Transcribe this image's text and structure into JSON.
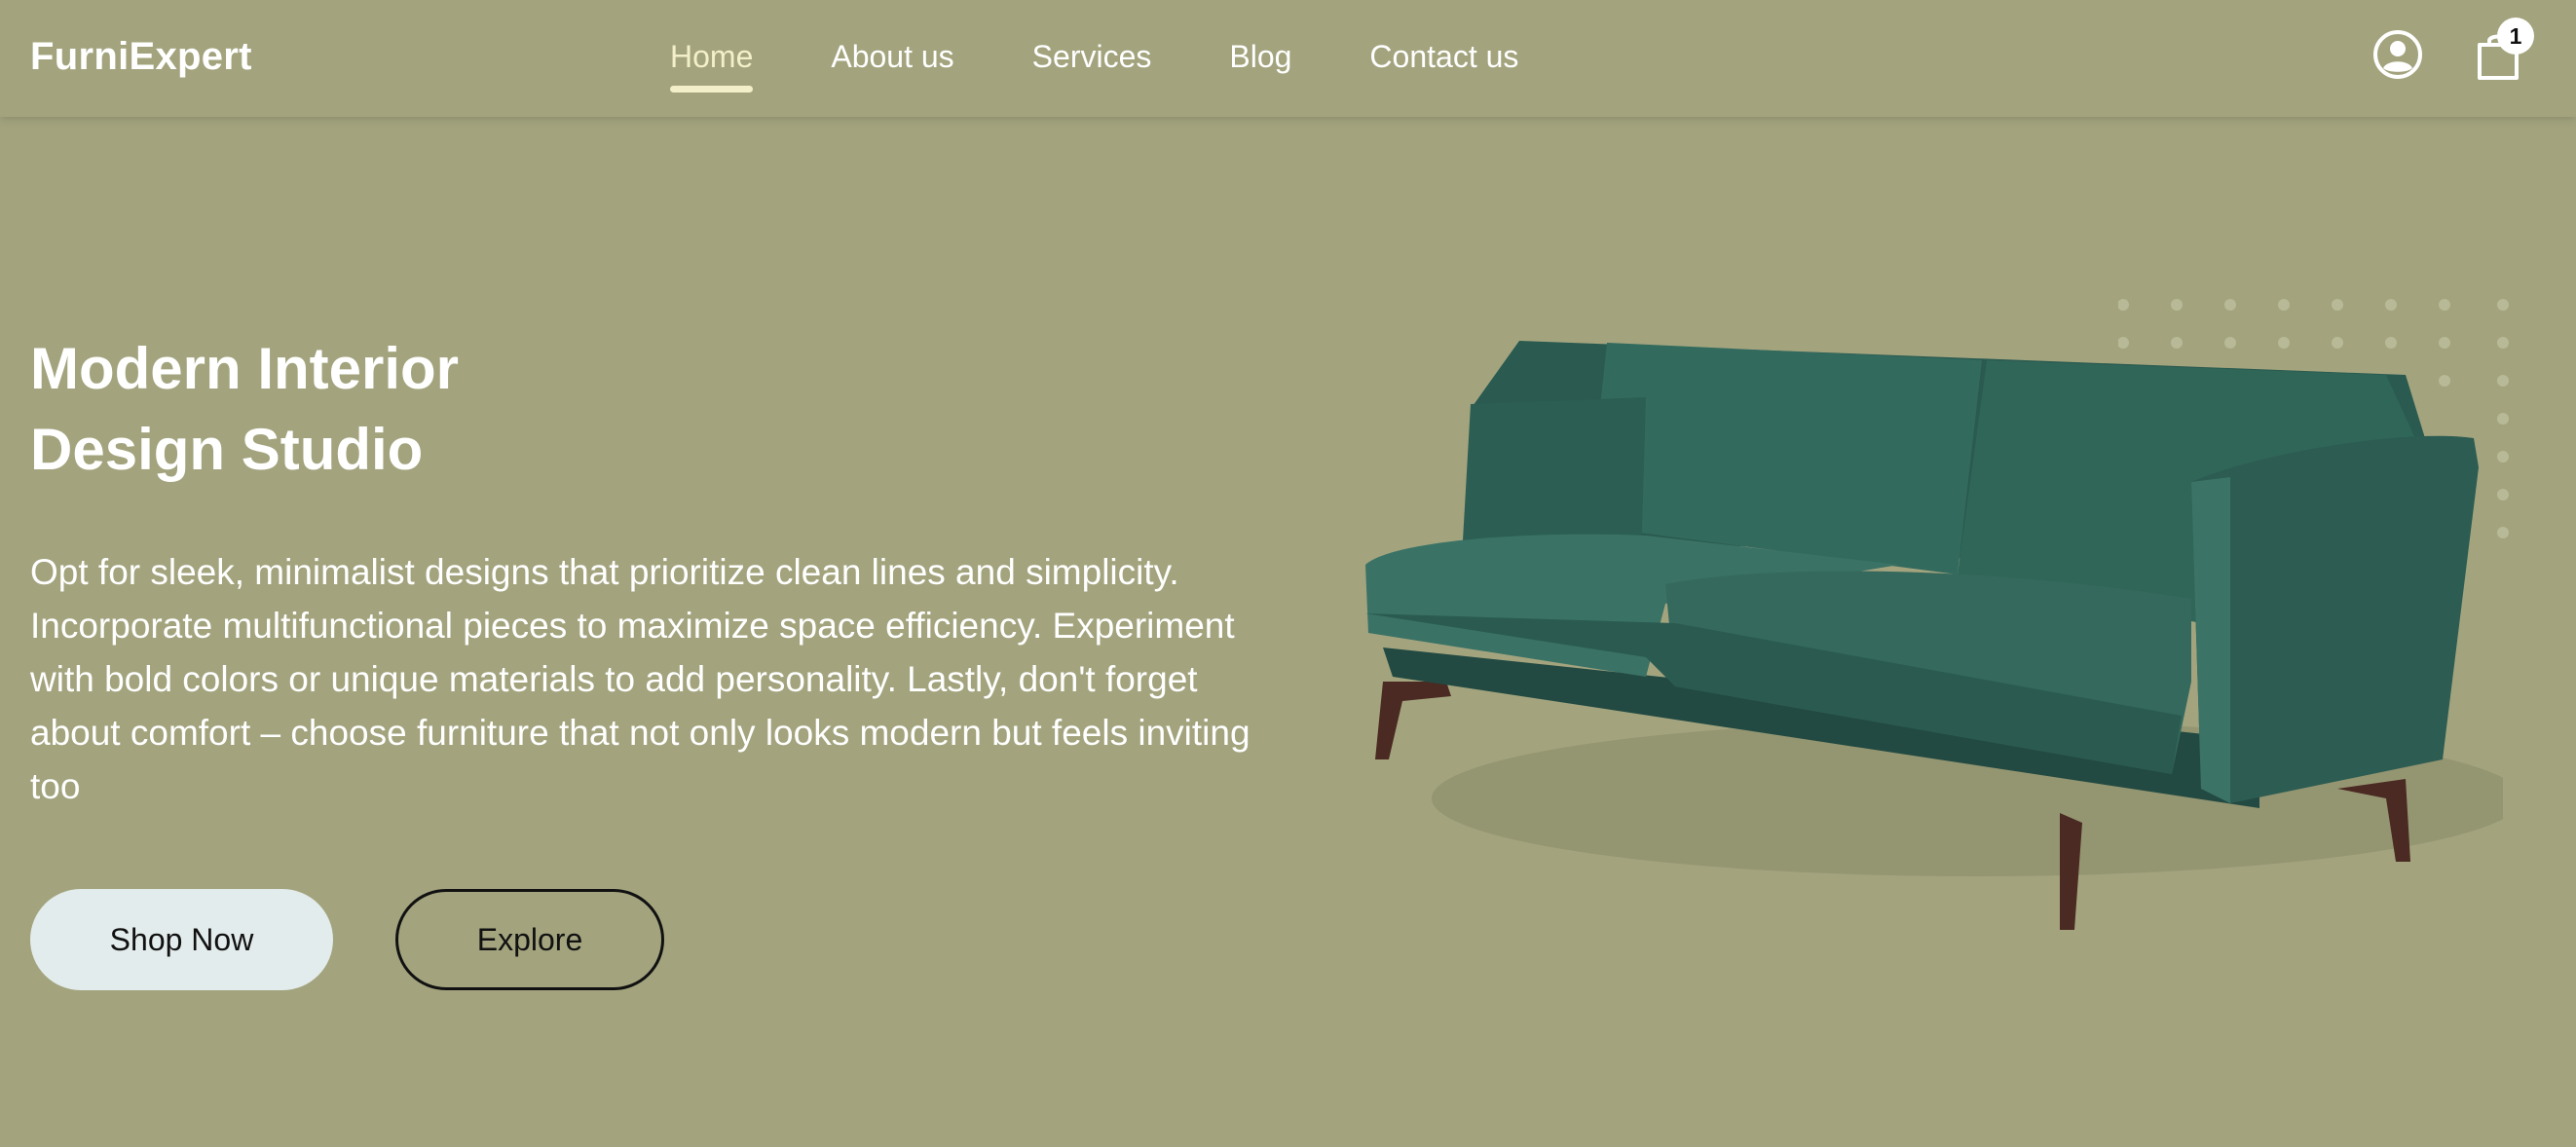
{
  "brand": "FurniExpert",
  "nav": {
    "items": [
      {
        "label": "Home",
        "active": true
      },
      {
        "label": "About us",
        "active": false
      },
      {
        "label": "Services",
        "active": false
      },
      {
        "label": "Blog",
        "active": false
      },
      {
        "label": "Contact us",
        "active": false
      }
    ]
  },
  "header_icons": {
    "user": "user-circle-icon",
    "cart": "shopping-bag-icon",
    "cart_count": "1"
  },
  "hero": {
    "title_line1": "Modern Interior",
    "title_line2": "Design Studio",
    "description": "Opt for sleek, minimalist designs that prioritize clean lines and simplicity. Incorporate multifunctional pieces to maximize space efficiency. Experiment with bold colors or unique materials to add personality. Lastly, don't forget about comfort – choose furniture that not only looks modern but feels inviting too",
    "primary_button": "Shop Now",
    "secondary_button": "Explore"
  },
  "colors": {
    "background": "#a3a47e",
    "accent": "#f3efc9",
    "sofa": "#2f5f55",
    "primary_button_bg": "#e3ecec"
  }
}
